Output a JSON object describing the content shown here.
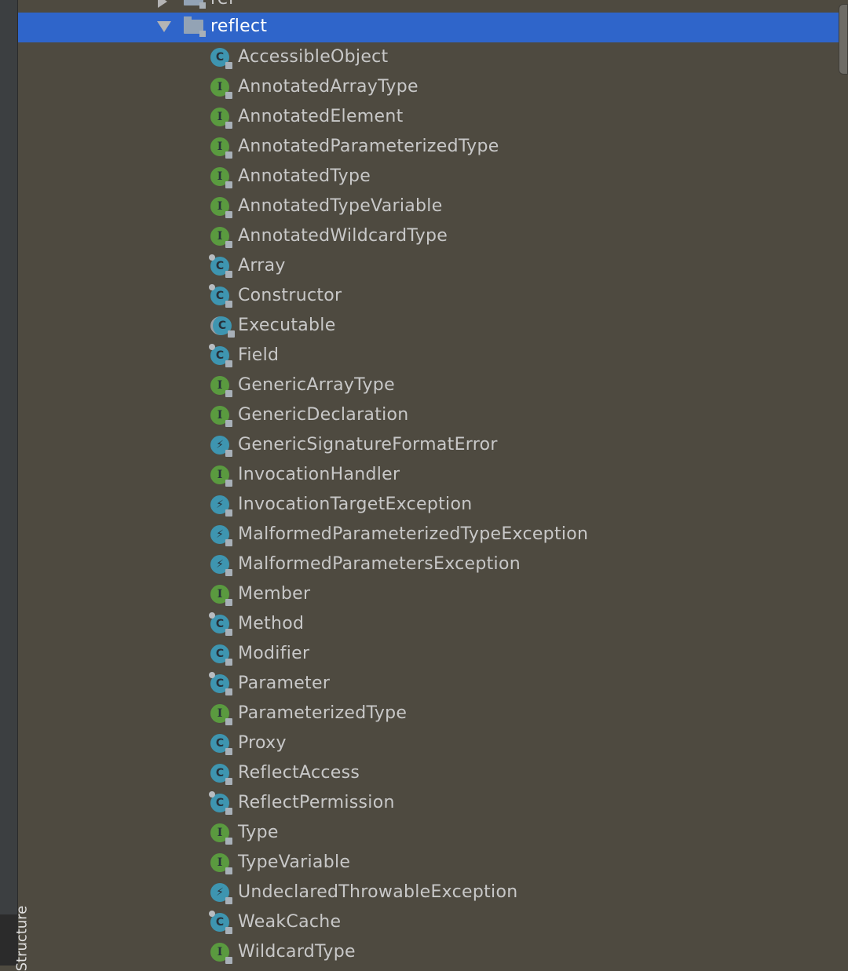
{
  "tool_window_tab": "Structure",
  "tree": {
    "partial_item": "ref",
    "selected_folder": "reflect",
    "items": [
      {
        "label": "AccessibleObject",
        "kind": "class"
      },
      {
        "label": "AnnotatedArrayType",
        "kind": "interface"
      },
      {
        "label": "AnnotatedElement",
        "kind": "interface"
      },
      {
        "label": "AnnotatedParameterizedType",
        "kind": "interface"
      },
      {
        "label": "AnnotatedType",
        "kind": "interface"
      },
      {
        "label": "AnnotatedTypeVariable",
        "kind": "interface"
      },
      {
        "label": "AnnotatedWildcardType",
        "kind": "interface"
      },
      {
        "label": "Array",
        "kind": "final-class"
      },
      {
        "label": "Constructor",
        "kind": "final-class"
      },
      {
        "label": "Executable",
        "kind": "abstract-class"
      },
      {
        "label": "Field",
        "kind": "final-class"
      },
      {
        "label": "GenericArrayType",
        "kind": "interface"
      },
      {
        "label": "GenericDeclaration",
        "kind": "interface"
      },
      {
        "label": "GenericSignatureFormatError",
        "kind": "exception"
      },
      {
        "label": "InvocationHandler",
        "kind": "interface"
      },
      {
        "label": "InvocationTargetException",
        "kind": "exception"
      },
      {
        "label": "MalformedParameterizedTypeException",
        "kind": "exception"
      },
      {
        "label": "MalformedParametersException",
        "kind": "exception"
      },
      {
        "label": "Member",
        "kind": "interface"
      },
      {
        "label": "Method",
        "kind": "final-class"
      },
      {
        "label": "Modifier",
        "kind": "class"
      },
      {
        "label": "Parameter",
        "kind": "final-class"
      },
      {
        "label": "ParameterizedType",
        "kind": "interface"
      },
      {
        "label": "Proxy",
        "kind": "class"
      },
      {
        "label": "ReflectAccess",
        "kind": "class"
      },
      {
        "label": "ReflectPermission",
        "kind": "final-class"
      },
      {
        "label": "Type",
        "kind": "interface"
      },
      {
        "label": "TypeVariable",
        "kind": "interface"
      },
      {
        "label": "UndeclaredThrowableException",
        "kind": "exception"
      },
      {
        "label": "WeakCache",
        "kind": "final-class"
      },
      {
        "label": "WildcardType",
        "kind": "interface"
      }
    ]
  },
  "colors": {
    "background": "#4e4a40",
    "selection": "#2f65ca",
    "class_icon": "#3e95b0",
    "interface_icon": "#5a9a3f"
  }
}
